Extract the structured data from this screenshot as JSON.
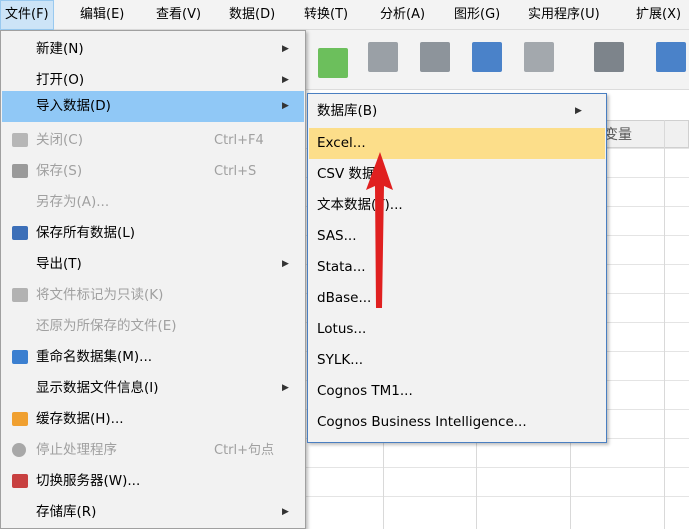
{
  "menubar": {
    "items": [
      {
        "label": "文件(F)",
        "active": true
      },
      {
        "label": "编辑(E)"
      },
      {
        "label": "查看(V)"
      },
      {
        "label": "数据(D)"
      },
      {
        "label": "转换(T)"
      },
      {
        "label": "分析(A)"
      },
      {
        "label": "图形(G)"
      },
      {
        "label": "实用程序(U)"
      },
      {
        "label": "扩展(X)"
      }
    ]
  },
  "background": {
    "variable_column_header": "变量"
  },
  "file_menu": {
    "items": [
      {
        "label": "新建(N)",
        "submenu": true,
        "disabled": false,
        "icon": null
      },
      {
        "label": "打开(O)",
        "submenu": true,
        "disabled": false,
        "icon": null
      },
      {
        "label": "导入数据(D)",
        "submenu": true,
        "disabled": false,
        "highlighted": true,
        "icon": null
      },
      {
        "label": "关闭(C)",
        "shortcut": "Ctrl+F4",
        "disabled": true,
        "icon": "close-doc-icon"
      },
      {
        "label": "保存(S)",
        "shortcut": "Ctrl+S",
        "disabled": true,
        "icon": "save-icon"
      },
      {
        "label": "另存为(A)...",
        "disabled": true,
        "icon": null
      },
      {
        "label": "保存所有数据(L)",
        "disabled": false,
        "icon": "save-all-icon"
      },
      {
        "label": "导出(T)",
        "submenu": true,
        "disabled": false,
        "icon": null
      },
      {
        "label": "将文件标记为只读(K)",
        "disabled": true,
        "icon": "read-only-icon"
      },
      {
        "label": "还原为所保存的文件(E)",
        "disabled": true,
        "icon": null
      },
      {
        "label": "重命名数据集(M)...",
        "disabled": false,
        "icon": "rename-dataset-icon"
      },
      {
        "label": "显示数据文件信息(I)",
        "submenu": true,
        "disabled": false,
        "icon": null
      },
      {
        "label": "缓存数据(H)...",
        "disabled": false,
        "icon": "cache-data-icon"
      },
      {
        "label": "停止处理程序",
        "shortcut": "Ctrl+句点",
        "disabled": true,
        "icon": "stop-icon"
      },
      {
        "label": "切换服务器(W)...",
        "disabled": false,
        "icon": "switch-server-icon"
      },
      {
        "label": "存储库(R)",
        "submenu": true,
        "disabled": false,
        "icon": null
      }
    ]
  },
  "import_submenu": {
    "items": [
      {
        "label": "数据库(B)",
        "submenu": true
      },
      {
        "label": "Excel...",
        "highlighted": true
      },
      {
        "label": "CSV 数据..."
      },
      {
        "label": "文本数据(T)..."
      },
      {
        "label": "SAS..."
      },
      {
        "label": "Stata..."
      },
      {
        "label": "dBase..."
      },
      {
        "label": "Lotus..."
      },
      {
        "label": "SYLK..."
      },
      {
        "label": "Cognos TM1..."
      },
      {
        "label": "Cognos Business Intelligence..."
      }
    ]
  },
  "colors": {
    "file_highlight": "#90c8f6",
    "sub_highlight": "#fcde8a",
    "annotation_arrow": "#e02020"
  }
}
